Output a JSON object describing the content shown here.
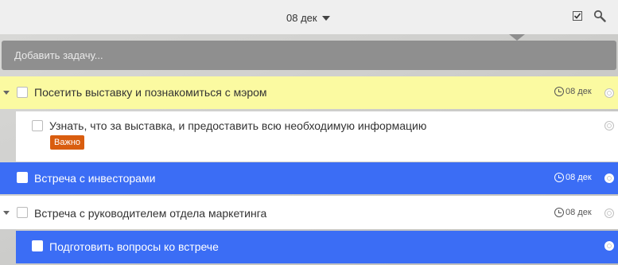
{
  "header": {
    "date_label": "08 дек",
    "icons": {
      "date_dropdown": "caret-down",
      "completed": "checkbox-icon",
      "search": "search-icon"
    }
  },
  "add_task": {
    "placeholder": "Добавить задачу..."
  },
  "colors": {
    "selected": "#3b6df5",
    "highlight": "#fbfaa1",
    "badge": "#d95d0f"
  },
  "tasks": [
    {
      "title": "Посетить выставку и познакомиться с мэром",
      "due": "08 дек",
      "expanded": true,
      "subtasks": [
        {
          "title": "Узнать, что за выставка, и предоставить всю необходимую информацию",
          "badge": "Важно"
        }
      ]
    },
    {
      "title": "Встреча с инвесторами",
      "due": "08 дек"
    },
    {
      "title": "Встреча с руководителем отдела маркетинга",
      "due": "08 дек",
      "expanded": true,
      "subtasks": [
        {
          "title": "Подготовить вопросы ко встрече"
        }
      ]
    }
  ]
}
